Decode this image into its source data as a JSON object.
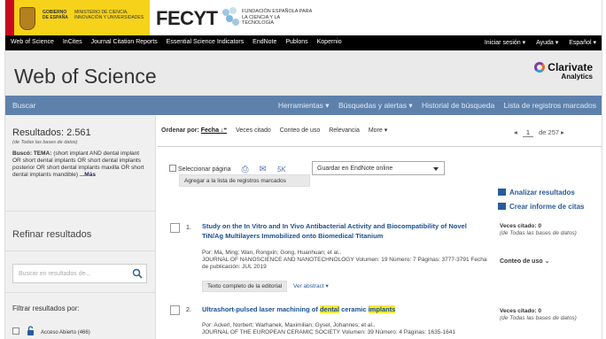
{
  "banner": {
    "gov_line1": "GOBIERNO DE ESPAÑA",
    "gov_line2": "MINISTERIO DE CIENCIA, INNOVACIÓN Y UNIVERSIDADES",
    "fecyt": "FECYT",
    "fecyt_sub": "FUNDACIÓN ESPAÑOLA PARA LA CIENCIA Y LA TECNOLOGÍA"
  },
  "topnav": {
    "left": [
      "Web of Science",
      "InCites",
      "Journal Citation Reports",
      "Essential Science Indicators",
      "EndNote",
      "Publons",
      "Kopernio"
    ],
    "right": [
      "Iniciar sesión ▾",
      "Ayuda ▾",
      "Español ▾"
    ]
  },
  "header": {
    "title": "Web of Science",
    "brand": "Clarivate",
    "brand_sub": "Analytics"
  },
  "bluebar": {
    "buscar": "Buscar",
    "menu": [
      "Herramientas ▾",
      "Búsquedas y alertas ▾",
      "Historial de búsqueda",
      "Lista de registros marcados"
    ]
  },
  "sidebar": {
    "results": "Resultados: 2.561",
    "results_sub": "(de Todas las bases de datos)",
    "tema_label": "Buscó: TEMA:",
    "tema_query": "(short implant AND dental implant OR short dental implants OR short dental implants posterior OR short dental implants maxilla OR short dental implants mandible)",
    "mas": "...Más",
    "refinar": "Refinar resultados",
    "search_placeholder": "Buscar en resultados de...",
    "filtrar": "Filtrar resultados por:",
    "open_access": "Acceso Abierto (466)"
  },
  "sort": {
    "label": "Ordenar por:",
    "options": [
      "Fecha ↓⁼",
      "Veces citado",
      "Conteo de uso",
      "Relevancia",
      "More ▾"
    ],
    "page_prev": "◂",
    "page": "1",
    "page_of": "de 257",
    "page_next": "▸"
  },
  "selection": {
    "select_page": "Seleccionar página",
    "count": "5K",
    "endnote": "Guardar en EndNote online",
    "add_marked": "Agregar a la lista de registros marcados"
  },
  "analysis": {
    "analyze": "Analizar resultados",
    "report": "Crear informe de citas"
  },
  "records": [
    {
      "num": "1.",
      "title": "Study on the In Vitro and In Vivo Antibacterial Activity and Biocompatibility of Novel TiN/Ag Multilayers Immobilized onto Biomedical Titanium",
      "authors": "Por: Ma, Ming; Wan, Rongxin; Gong, Huanhuan; et al..",
      "journal": "JOURNAL OF NANOSCIENCE AND NANOTECHNOLOGY Volumen: 19 Número: 7 Páginas: 3777-3791 Fecha de publicación: JUL 2019",
      "full_text": "Texto completo de la editorial",
      "abstract": "Ver abstract ▾",
      "cited": "Veces citado: 0",
      "cited_sub": "(de Todas las bases de datos)",
      "uso": "Conteo de uso",
      "uso_arrow": "⌄"
    },
    {
      "num": "2.",
      "title_pre": "Ultrashort-pulsed laser machining of ",
      "title_hl1": "dental",
      "title_mid": " ceramic ",
      "title_hl2": "implants",
      "authors": "Por: Ackerl, Norbert; Warhanek, Maximilian; Gysel, Johannes; et al..",
      "journal": "JOURNAL OF THE EUROPEAN CERAMIC SOCIETY Volumen: 39 Número: 4 Páginas: 1635-1641",
      "cited": "Veces citado: 0",
      "cited_sub": "(de Todas las bases de datos)"
    }
  ],
  "colors": {
    "nav_bg": "#000000",
    "header_bg": "#eaeaea",
    "bluebar": "#5e81ac",
    "link": "#1a4e92",
    "highlight": "#f6ea3a"
  }
}
